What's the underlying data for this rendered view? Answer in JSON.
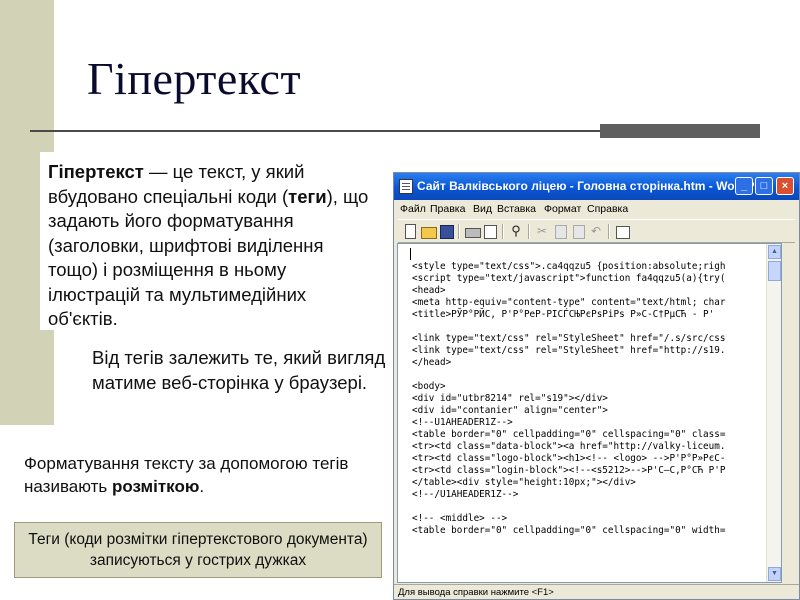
{
  "slide": {
    "title": "Гіпертекст",
    "p1": {
      "term": "Гіпертекст",
      "text_a": " — це текст, у який вбудовано спеціальні коди (",
      "tags_word": "теги",
      "text_b": "), що задають його форматування (заголовки, шрифтові виділення тощо) і розміщення в ньому ілюстрацій та мультимедійних об'єктів."
    },
    "p2": "Від тегів залежить те, який вигляд матиме веб-сторінка у браузері.",
    "p3": {
      "text": "Форматування тексту за допомогою тегів називають ",
      "bold": "розміткою",
      "end": "."
    },
    "note": "Теги (коди розмітки гіпертекстового документа)  записуються у гострих дужках"
  },
  "window": {
    "title": "Сайт Валківського ліцею - Головна сторінка.htm - WordPad",
    "menu": [
      "Файл",
      "Правка",
      "Вид",
      "Вставка",
      "Формат",
      "Справка"
    ],
    "toolbar_icons": [
      "new-icon",
      "open-icon",
      "save-icon",
      "print-icon",
      "print-preview-icon",
      "find-icon",
      "cut-icon",
      "copy-icon",
      "paste-icon",
      "undo-icon",
      "date-time-icon"
    ],
    "code_lines": [
      "<style type=\"text/css\">.ca4qqzu5 {position:absolute;righ",
      "<script type=\"text/javascript\">function fa4qqzu5(a){try(",
      "<head>",
      "<meta http-equiv=\"content-type\" content=\"text/html; char",
      "<title>РЎР°РЙС, Р'Р°РеР-РІСЃСЊРєРѕРіРѕ Р»С-С†РµСЋ - Р'",
      "",
      "<link type=\"text/css\" rel=\"StyleSheet\" href=\"/.s/src/css",
      "<link type=\"text/css\" rel=\"StyleSheet\" href=\"http://s19.",
      "</head>",
      "",
      "<body>",
      "<div id=\"utbr8214\" rel=\"s19\"></div>",
      "<div id=\"contanier\" align=\"center\">",
      "<!--U1AHEADER1Z-->",
      "<table border=\"0\" cellpadding=\"0\" cellspacing=\"0\" class=",
      "<tr><td class=\"data-block\"><a href=\"http://valky-liceum.",
      "<tr><td class=\"logo-block\"><h1><!-- <logo> -->Р'Р°Р»РєС-",
      "<tr><td class=\"login-block\"><!--<s5212>-->Р'С–С,Р°СЋ Р'Р",
      "</table><div style=\"height:10px;\"></div>",
      "<!--/U1AHEADER1Z-->",
      "",
      "<!-- <middle> -->",
      "<table border=\"0\" cellpadding=\"0\" cellspacing=\"0\" width="
    ],
    "status": "Для вывода справки нажмите <F1>"
  }
}
